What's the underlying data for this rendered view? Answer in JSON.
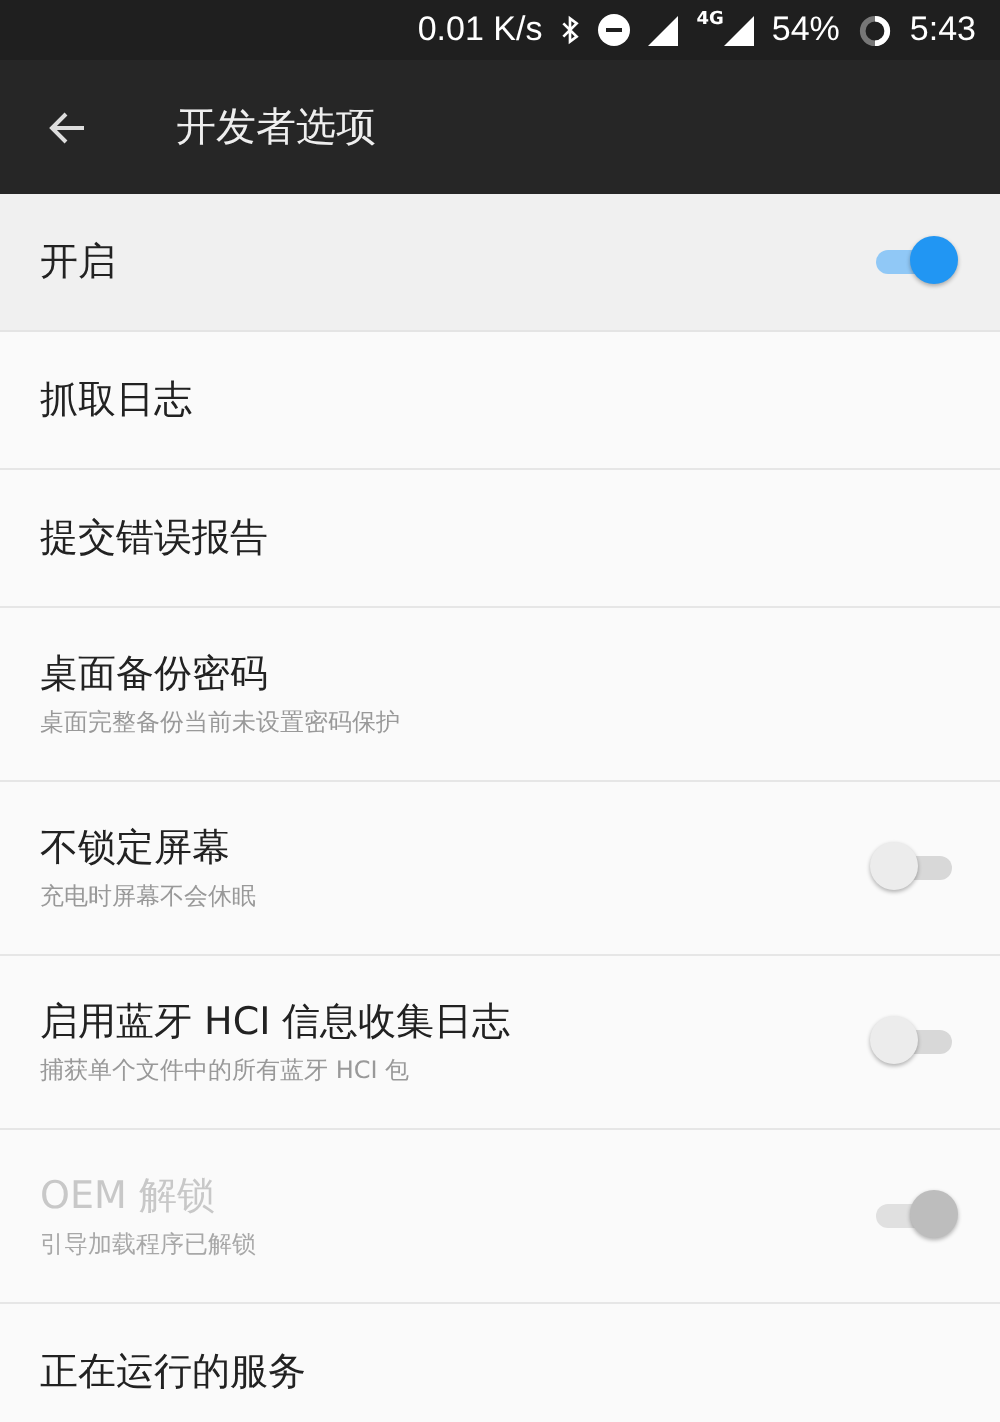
{
  "status_bar": {
    "speed": "0.01 K/s",
    "network": "4G",
    "battery": "54%",
    "time": "5:43"
  },
  "toolbar": {
    "title": "开发者选项"
  },
  "master_switch": {
    "label": "开启",
    "on": true
  },
  "items": [
    {
      "kind": "plain",
      "title": "抓取日志",
      "disabled": false
    },
    {
      "kind": "plain",
      "title": "提交错误报告",
      "disabled": false
    },
    {
      "kind": "plain",
      "title": "桌面备份密码",
      "subtitle": "桌面完整备份当前未设置密码保护",
      "disabled": false
    },
    {
      "kind": "switch",
      "title": "不锁定屏幕",
      "subtitle": "充电时屏幕不会休眠",
      "on": false,
      "disabled": false
    },
    {
      "kind": "switch",
      "title": "启用蓝牙 HCI 信息收集日志",
      "subtitle": "捕获单个文件中的所有蓝牙 HCI 包",
      "on": false,
      "disabled": false
    },
    {
      "kind": "switch",
      "title": "OEM 解锁",
      "subtitle": "引导加载程序已解锁",
      "on": true,
      "disabled": true
    },
    {
      "kind": "plain",
      "title": "正在运行的服务",
      "disabled": false
    }
  ]
}
